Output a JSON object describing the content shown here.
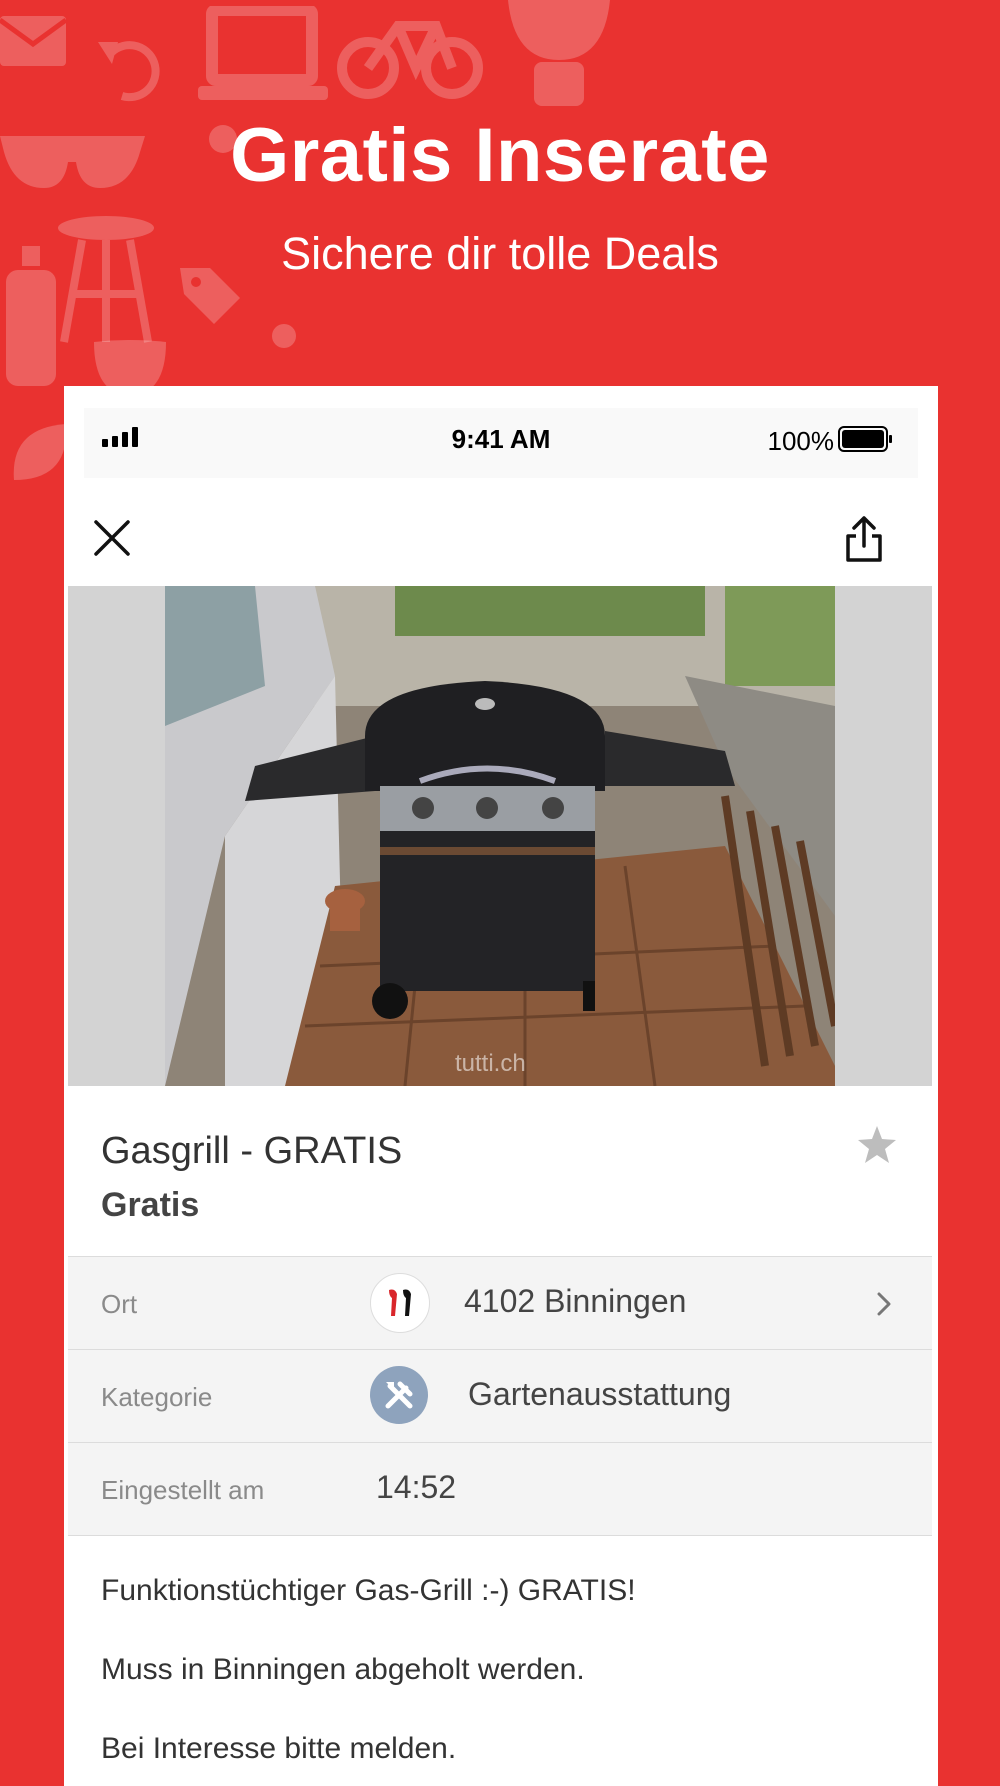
{
  "hero": {
    "title": "Gratis Inserate",
    "subtitle": "Sichere dir tolle Deals"
  },
  "statusbar": {
    "time": "9:41 AM",
    "battery": "100%"
  },
  "listing": {
    "title": "Gasgrill - GRATIS",
    "price": "Gratis",
    "image_watermark": "tutti.ch"
  },
  "details": [
    {
      "label": "Ort",
      "value": "4102 Binningen",
      "icon": "canton-flag-icon"
    },
    {
      "label": "Kategorie",
      "value": "Gartenausstattung",
      "icon": "tools-icon"
    },
    {
      "label": "Eingestellt am",
      "value": "14:52"
    }
  ],
  "description": [
    "Funktionstüchtiger Gas-Grill :-) GRATIS!",
    "Muss in Binningen abgeholt werden.",
    "Bei Interesse bitte melden."
  ],
  "colors": {
    "brand_red": "#e93230",
    "category_badge": "#8ea3bd"
  }
}
